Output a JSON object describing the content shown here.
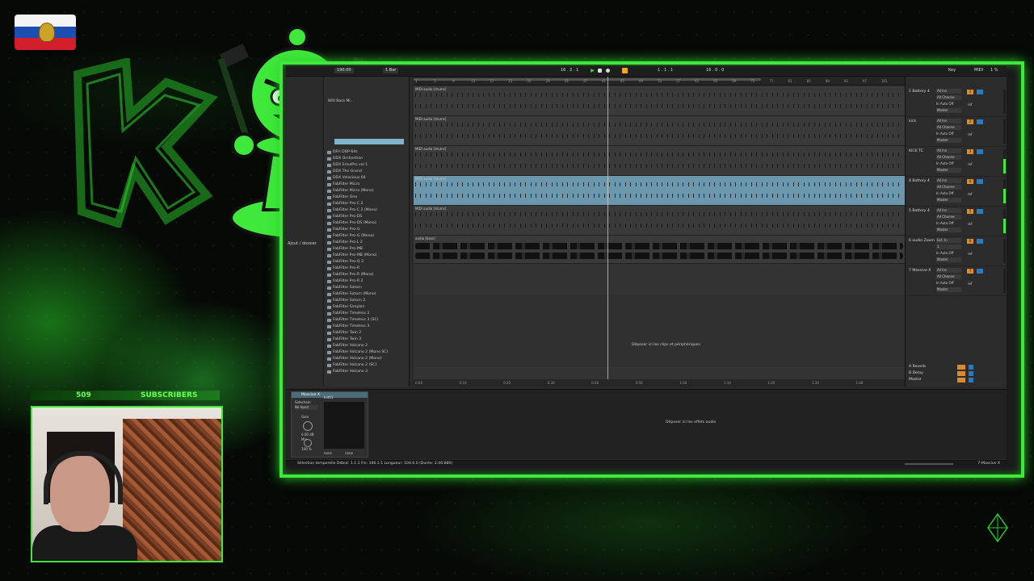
{
  "stream": {
    "subscriber_count": "509",
    "subscriber_label": "SUBSCRIBERS"
  },
  "transport": {
    "tempo": "190.00",
    "quantize": "1 Bar",
    "position": "16 . 2 . 1",
    "loop_start": "1 . 1 . 1",
    "loop_length": "16 . 0 . 0",
    "key_label": "Key",
    "midi_label": "MIDI",
    "cpu": "1 %"
  },
  "browser": {
    "pack_label": "800 Bass Mi...",
    "place_label": "Ajout / dossier",
    "items": [
      "DFH DDP-64s",
      "DDX Orchestron",
      "DDX EmulPro vol 1",
      "DDX The Grand",
      "DDX Velocious 64",
      "FabFilter Micro",
      "FabFilter Micro (Mono)",
      "FabFilter One",
      "FabFilter Pro-C 2",
      "FabFilter Pro-C 2 (Mono)",
      "FabFilter Pro-DS",
      "FabFilter Pro-DS (Mono)",
      "FabFilter Pro-G",
      "FabFilter Pro-G (Mono)",
      "FabFilter Pro-L 2",
      "FabFilter Pro-MB",
      "FabFilter Pro-MB (Mono)",
      "FabFilter Pro-Q 3",
      "FabFilter Pro-R",
      "FabFilter Pro-R (Mono)",
      "FabFilter Pro-R 2",
      "FabFilter Saturn",
      "FabFilter Saturn (Mono)",
      "FabFilter Saturn 2",
      "FabFilter Simplon",
      "FabFilter Timeless 2",
      "FabFilter Timeless 3 (SC)",
      "FabFilter Timeless 3",
      "FabFilter Twin 2",
      "FabFilter Twin 3",
      "FabFilter Volcano 2",
      "FabFilter Volcano 2 (Mono SC)",
      "FabFilter Volcano 2 (Mono)",
      "FabFilter Volcano 2 (SC)",
      "FabFilter Volcano 3"
    ]
  },
  "arrangement": {
    "ruler_ticks": [
      "1",
      "5",
      "9",
      "13",
      "17",
      "21",
      "25",
      "29",
      "33",
      "37",
      "41",
      "45",
      "49",
      "53",
      "57",
      "61",
      "65",
      "69",
      "73",
      "77",
      "81",
      "85",
      "89",
      "93",
      "97",
      "101"
    ],
    "time_ticks": [
      "0:00",
      "0:10",
      "0:20",
      "0:30",
      "0:40",
      "0:50",
      "1:00",
      "1:10",
      "1:20",
      "1:30",
      "1:40"
    ],
    "tracks": [
      {
        "label": "MIDI audio [drums]"
      },
      {
        "label": "MIDI audio [drums]"
      },
      {
        "label": "MIDI audio [drums]"
      },
      {
        "label": "MIDI audio [drums]"
      },
      {
        "label": "MIDI audio [drums]"
      },
      {
        "label": "audio [bass]"
      }
    ],
    "drop_text": "Déposer ici les clips et périphériques"
  },
  "mixer": {
    "strips": [
      {
        "name": "1 Battery 4",
        "input": "All Ins",
        "channel": "All Channe",
        "monitor": "In Auto Off",
        "out": "Master",
        "num": "1",
        "vol": "-inf"
      },
      {
        "name": "kick",
        "input": "All Ins",
        "channel": "All Channe",
        "monitor": "In Auto Off",
        "out": "Master",
        "num": "2",
        "vol": "-inf"
      },
      {
        "name": "KICK TC",
        "input": "All Ins",
        "channel": "All Channe",
        "monitor": "In Auto Off",
        "out": "Master",
        "num": "3",
        "vol": "-inf"
      },
      {
        "name": "4 Battery 4",
        "input": "All Ins",
        "channel": "All Channe",
        "monitor": "In Auto Off",
        "out": "Master",
        "num": "4",
        "vol": "-inf"
      },
      {
        "name": "5 Battery 4",
        "input": "All Ins",
        "channel": "All Channe",
        "monitor": "In Auto Off",
        "out": "Master",
        "num": "5",
        "vol": "-inf"
      },
      {
        "name": "6 audio Zoom",
        "input": "Ext. In",
        "channel": "1",
        "monitor": "In Auto Off",
        "out": "Master",
        "num": "6",
        "vol": "-inf"
      },
      {
        "name": "7 Massive X",
        "input": "All Ins",
        "channel": "All Channe",
        "monitor": "In Auto Off",
        "out": "Master",
        "num": "7",
        "vol": "-inf"
      }
    ],
    "returns": [
      "A Reverb",
      "B Delay",
      "Master"
    ]
  },
  "device": {
    "title": "Massive X",
    "sidechain_label": "Sidechain",
    "input": "No Input",
    "gain_label": "Gain",
    "gain_value": "0.00 dB",
    "mix_label": "Mix",
    "mix_value": "100 %",
    "preset": "Init01",
    "none1": "none",
    "none2": "none",
    "drop_text": "Déposer ici les effets audio"
  },
  "status": {
    "left": "Sélection temporelle   Début: 1.1.1   Fin: 106.1.1   Longueur: 104.0.0   (Durée: 2:46:880)",
    "right": "7-Massive X"
  },
  "colors": {
    "frame": "#3fe83a",
    "accent_orange": "#f5a623",
    "accent_blue": "#2a7ac0",
    "selected_track": "#6a97ab"
  }
}
